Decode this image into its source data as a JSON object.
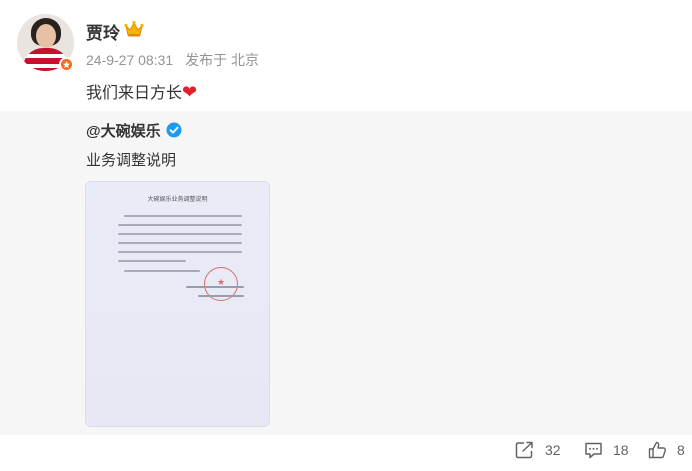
{
  "author": {
    "name": "贾玲",
    "timestamp": "24-9-27 08:31",
    "source": "发布于 北京"
  },
  "post": {
    "text": "我们来日方长",
    "emoji": "❤"
  },
  "repost": {
    "author": "@大碗娱乐",
    "text": "业务调整说明",
    "document": {
      "title": "大碗娱乐业务调整说明"
    }
  },
  "actions": {
    "share_count": "32",
    "comment_count": "18",
    "like_count": "8"
  },
  "colors": {
    "heart": "#e0202b",
    "verified_blue": "#1d9bf0",
    "badge_orange": "#f26a1b",
    "stamp_red": "#e06a66"
  },
  "icons": [
    "crown-icon",
    "verified-icon",
    "share-icon",
    "comment-icon",
    "like-icon"
  ]
}
